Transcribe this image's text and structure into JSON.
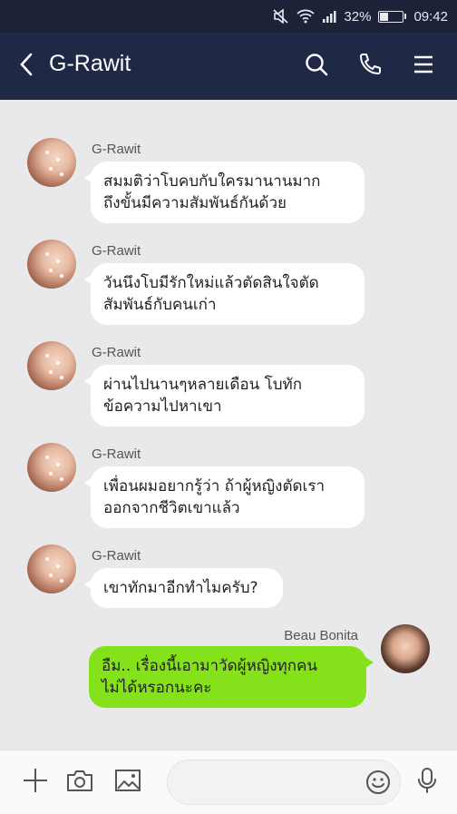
{
  "status_bar": {
    "battery": "32%",
    "battery_level": 0.32,
    "time": "09:42"
  },
  "header": {
    "title": "G-Rawit"
  },
  "messages": [
    {
      "sender": "G-Rawit",
      "lines": [
        "สมมติว่าโบคบกับใครมานานมาก",
        "ถึงขั้นมีความสัมพันธ์กันด้วย"
      ]
    },
    {
      "sender": "G-Rawit",
      "lines": [
        "วันนึงโบมีรักใหม่แล้วตัดสินใจตัด",
        "สัมพันธ์กับคนเก่า"
      ]
    },
    {
      "sender": "G-Rawit",
      "lines": [
        "ผ่านไปนานๆหลายเดือน โบทัก",
        "ข้อความไปหาเขา"
      ]
    },
    {
      "sender": "G-Rawit",
      "lines": [
        "เพื่อนผมอยากรู้ว่า ถ้าผู้หญิงตัดเรา",
        "ออกจากชีวิตเขาแล้ว"
      ]
    },
    {
      "sender": "G-Rawit",
      "lines": [
        "เขาทักมาอีกทำไมครับ?"
      ]
    },
    {
      "sender": "Beau Bonita",
      "lines": [
        "อืม.. เรื่องนี้เอามาวัดผู้หญิงทุกคน",
        "ไม่ได้หรอกนะคะ"
      ]
    }
  ],
  "colors": {
    "header_bg": "#1f2845",
    "status_bg": "#1c2238",
    "my_bubble": "#84e11a",
    "chat_bg": "#e9e9ec"
  },
  "icons": [
    "back-arrow-icon",
    "search-icon",
    "phone-icon",
    "menu-icon",
    "plus-icon",
    "camera-icon",
    "image-icon",
    "emoji-icon",
    "microphone-icon"
  ]
}
